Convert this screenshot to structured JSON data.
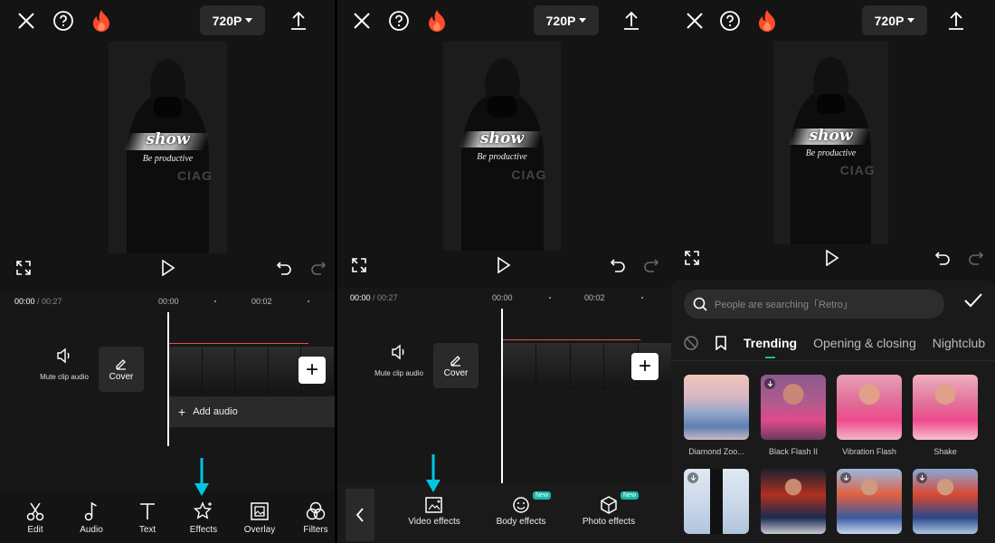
{
  "panel1": {
    "resolution": "720P",
    "video": {
      "overlay_title": "show",
      "overlay_subtitle": "Be productive",
      "jacket_text": "CIAG"
    },
    "timecode": {
      "current": "00:00",
      "separator": " / ",
      "total": "00:27"
    },
    "ruler": [
      "00:00",
      "00:02"
    ],
    "mute_label": "Mute clip audio",
    "cover_label": "Cover",
    "add_audio_label": "Add audio",
    "toolbar": [
      {
        "name": "edit",
        "label": "Edit",
        "icon": "scissors-icon"
      },
      {
        "name": "audio",
        "label": "Audio",
        "icon": "music-note-icon"
      },
      {
        "name": "text",
        "label": "Text",
        "icon": "text-t-icon"
      },
      {
        "name": "effects",
        "label": "Effects",
        "icon": "sparkle-star-icon"
      },
      {
        "name": "overlay",
        "label": "Overlay",
        "icon": "overlay-image-icon"
      },
      {
        "name": "filters",
        "label": "Filters",
        "icon": "filters-circles-icon"
      }
    ]
  },
  "panel2": {
    "resolution": "720P",
    "video": {
      "overlay_title": "show",
      "overlay_subtitle": "Be productive",
      "jacket_text": "CIAG"
    },
    "timecode": {
      "current": "00:00",
      "separator": " / ",
      "total": "00:27"
    },
    "ruler": [
      "00:00",
      "00:02"
    ],
    "mute_label": "Mute clip audio",
    "cover_label": "Cover",
    "effect_types": [
      {
        "label": "Video effects",
        "icon": "video-effects-icon",
        "badge": ""
      },
      {
        "label": "Body effects",
        "icon": "body-effects-icon",
        "badge": "New"
      },
      {
        "label": "Photo effects",
        "icon": "photo-effects-icon",
        "badge": "New"
      }
    ]
  },
  "panel3": {
    "resolution": "720P",
    "video": {
      "overlay_title": "show",
      "overlay_subtitle": "Be productive",
      "jacket_text": "CIAG"
    },
    "search_placeholder": "People are searching「Retro」",
    "tabs": [
      "Trending",
      "Opening & closing",
      "Nightclub"
    ],
    "active_tab": "Trending",
    "effects": [
      {
        "label": "Diamond Zoo...",
        "download": false
      },
      {
        "label": "Black Flash II",
        "download": true
      },
      {
        "label": "Vibration Flash",
        "download": false
      },
      {
        "label": "Shake",
        "download": false
      },
      {
        "label": "",
        "download": true
      },
      {
        "label": "",
        "download": false
      },
      {
        "label": "",
        "download": true
      },
      {
        "label": "",
        "download": true
      }
    ]
  },
  "colors": {
    "accent": "#1ab7a8",
    "flame": "#ff4b2b",
    "timeline_red": "#e55050",
    "arrow": "#00c6e0"
  }
}
